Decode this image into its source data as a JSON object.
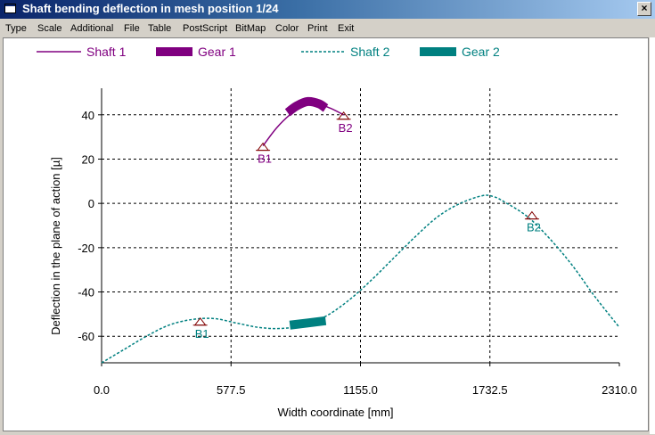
{
  "window": {
    "title": "Shaft bending deflection in mesh position 1/24",
    "close_glyph": "×"
  },
  "menu": [
    "Type",
    "Scale",
    "Additional",
    "File",
    "Table",
    "PostScript",
    "BitMap",
    "Color",
    "Print",
    "Exit"
  ],
  "colors": {
    "shaft1": "#800080",
    "shaft2": "#008080"
  },
  "chart_data": {
    "type": "line",
    "xlabel": "Width coordinate  [mm]",
    "ylabel": "Deflection in the plane of action  [µ]",
    "xlim": [
      0,
      2310
    ],
    "ylim": [
      -72,
      52
    ],
    "xticks": [
      "0.0",
      "577.5",
      "1155.0",
      "1732.5",
      "2310.0"
    ],
    "yticks": [
      "40",
      "20",
      "0",
      "-20",
      "-40",
      "-60"
    ],
    "legend": [
      "Shaft 1",
      "Gear 1",
      "Shaft 2",
      "Gear 2"
    ],
    "series": [
      {
        "name": "Shaft 1",
        "style": "solid",
        "x": [
          720,
          780,
          840,
          900,
          960,
          1020,
          1080
        ],
        "y": [
          26,
          34,
          40,
          44,
          45,
          43,
          40
        ]
      },
      {
        "name": "Gear 1",
        "style": "thick",
        "x": [
          830,
          870,
          920,
          970,
          1000
        ],
        "y": [
          41,
          44,
          46,
          45,
          43
        ]
      },
      {
        "name": "Shaft 2",
        "style": "dashed",
        "x": [
          0,
          100,
          200,
          300,
          400,
          500,
          600,
          700,
          800,
          900,
          1000,
          1100,
          1200,
          1300,
          1400,
          1500,
          1600,
          1700,
          1750,
          1800,
          1900,
          2000,
          2100,
          2200,
          2310
        ],
        "y": [
          -72,
          -66,
          -60,
          -55,
          -52.5,
          -52,
          -54,
          -56,
          -56.5,
          -55,
          -51,
          -44,
          -35,
          -25,
          -15,
          -6,
          0,
          3.5,
          3,
          0.5,
          -6,
          -16,
          -28,
          -42,
          -56
        ]
      },
      {
        "name": "Gear 2",
        "style": "thick",
        "x": [
          840,
          1000
        ],
        "y": [
          -55,
          -53
        ]
      }
    ],
    "bearings": [
      {
        "label": "B1",
        "series": "Shaft 1",
        "x": 720,
        "y": 26
      },
      {
        "label": "B2",
        "series": "Shaft 1",
        "x": 1080,
        "y": 40
      },
      {
        "label": "B1",
        "series": "Shaft 2",
        "x": 440,
        "y": -53
      },
      {
        "label": "B2",
        "series": "Shaft 2",
        "x": 1920,
        "y": -5
      }
    ]
  }
}
